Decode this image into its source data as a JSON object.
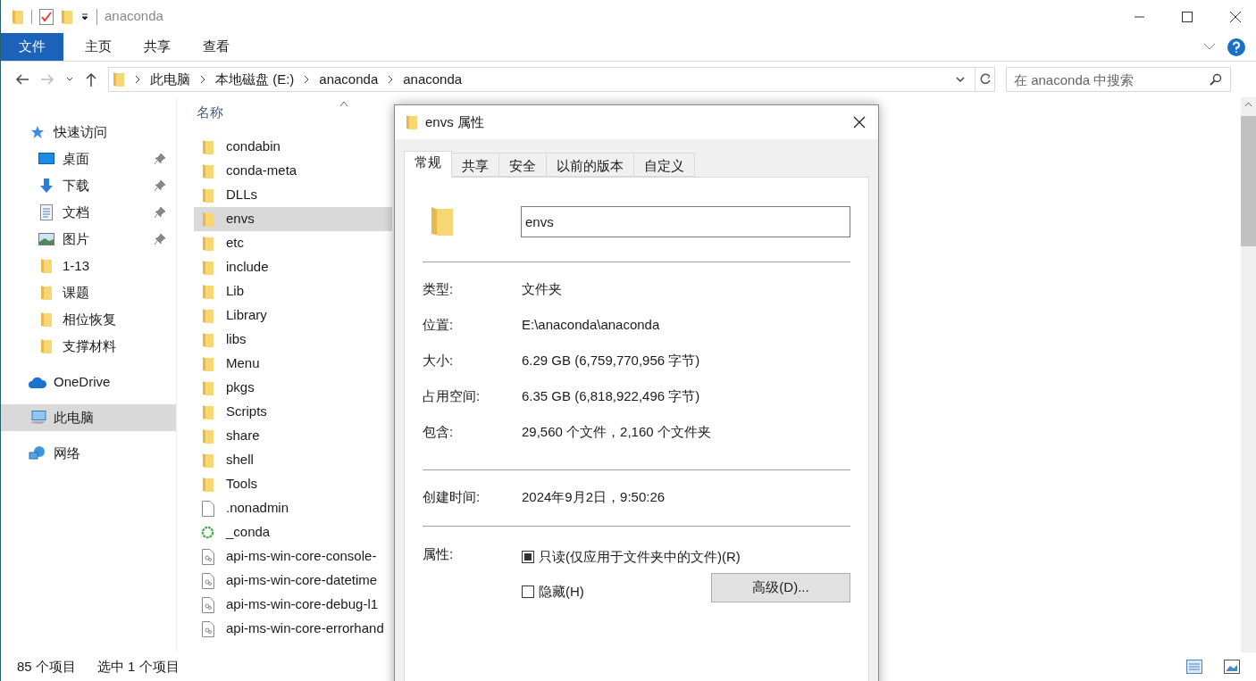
{
  "window": {
    "title": "anaconda"
  },
  "ribbon": {
    "tabs": [
      {
        "label": "文件",
        "selected": true
      },
      {
        "label": "主页",
        "selected": false
      },
      {
        "label": "共享",
        "selected": false
      },
      {
        "label": "查看",
        "selected": false
      }
    ]
  },
  "address_bar": {
    "path": [
      "此电脑",
      "本地磁盘 (E:)",
      "anaconda",
      "anaconda"
    ]
  },
  "search": {
    "placeholder": "在 anaconda 中搜索"
  },
  "sidebar": {
    "items": [
      {
        "label": "快速访问",
        "kind": "star",
        "selected": false,
        "children": [
          {
            "label": "桌面",
            "kind": "desktop",
            "pinned": true,
            "selected": false
          },
          {
            "label": "下载",
            "kind": "download",
            "pinned": true,
            "selected": false
          },
          {
            "label": "文档",
            "kind": "document",
            "pinned": true,
            "selected": false
          },
          {
            "label": "图片",
            "kind": "image",
            "pinned": true,
            "selected": false
          },
          {
            "label": "1-13",
            "kind": "folder",
            "pinned": false,
            "selected": false
          },
          {
            "label": "课题",
            "kind": "folder",
            "pinned": false,
            "selected": false
          },
          {
            "label": "相位恢复",
            "kind": "folder",
            "pinned": false,
            "selected": false
          },
          {
            "label": "支撑材料",
            "kind": "folder",
            "pinned": false,
            "selected": false
          }
        ]
      },
      {
        "label": "OneDrive",
        "kind": "cloud",
        "selected": false
      },
      {
        "label": "此电脑",
        "kind": "computer",
        "selected": true
      },
      {
        "label": "网络",
        "kind": "network",
        "selected": false
      }
    ]
  },
  "file_list": {
    "column": "名称",
    "items": [
      {
        "name": "condabin",
        "kind": "folder",
        "selected": false
      },
      {
        "name": "conda-meta",
        "kind": "folder",
        "selected": false
      },
      {
        "name": "DLLs",
        "kind": "folder",
        "selected": false
      },
      {
        "name": "envs",
        "kind": "folder",
        "selected": true
      },
      {
        "name": "etc",
        "kind": "folder",
        "selected": false
      },
      {
        "name": "include",
        "kind": "folder",
        "selected": false
      },
      {
        "name": "Lib",
        "kind": "folder",
        "selected": false
      },
      {
        "name": "Library",
        "kind": "folder",
        "selected": false
      },
      {
        "name": "libs",
        "kind": "folder",
        "selected": false
      },
      {
        "name": "Menu",
        "kind": "folder",
        "selected": false
      },
      {
        "name": "pkgs",
        "kind": "folder",
        "selected": false
      },
      {
        "name": "Scripts",
        "kind": "folder",
        "selected": false
      },
      {
        "name": "share",
        "kind": "folder",
        "selected": false
      },
      {
        "name": "shell",
        "kind": "folder",
        "selected": false
      },
      {
        "name": "Tools",
        "kind": "folder",
        "selected": false
      },
      {
        "name": ".nonadmin",
        "kind": "file",
        "selected": false
      },
      {
        "name": "_conda",
        "kind": "app",
        "selected": false
      },
      {
        "name": "api-ms-win-core-console-",
        "kind": "dll",
        "selected": false
      },
      {
        "name": "api-ms-win-core-datetime",
        "kind": "dll",
        "selected": false
      },
      {
        "name": "api-ms-win-core-debug-l1",
        "kind": "dll",
        "selected": false
      },
      {
        "name": "api-ms-win-core-errorhand",
        "kind": "dll",
        "selected": false
      }
    ]
  },
  "status_bar": {
    "count": "85 个项目",
    "selection": "选中 1 个项目"
  },
  "dialog": {
    "title": "envs 属性",
    "tabs": [
      {
        "label": "常规",
        "selected": true
      },
      {
        "label": "共享",
        "selected": false
      },
      {
        "label": "安全",
        "selected": false
      },
      {
        "label": "以前的版本",
        "selected": false
      },
      {
        "label": "自定义",
        "selected": false
      }
    ],
    "name_value": "envs",
    "sections": [
      [
        {
          "label": "类型:",
          "value": "文件夹"
        },
        {
          "label": "位置:",
          "value": "E:\\anaconda\\anaconda"
        },
        {
          "label": "大小:",
          "value": "6.29 GB (6,759,770,956 字节)"
        },
        {
          "label": "占用空间:",
          "value": "6.35 GB (6,818,922,496 字节)"
        },
        {
          "label": "包含:",
          "value": "29,560 个文件，2,160 个文件夹"
        }
      ],
      [
        {
          "label": "创建时间:",
          "value": "2024年9月2日，9:50:26"
        }
      ]
    ],
    "attributes": {
      "label": "属性:",
      "options": [
        {
          "label": "只读(仅应用于文件夹中的文件)(R)",
          "checked": true
        },
        {
          "label": "隐藏(H)",
          "checked": false
        }
      ]
    },
    "advanced_button": "高级(D)..."
  }
}
